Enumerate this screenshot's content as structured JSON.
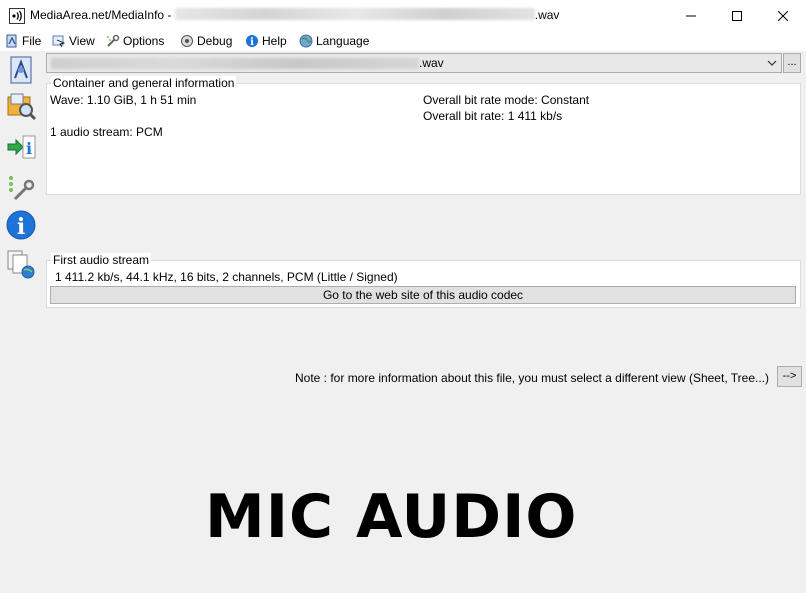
{
  "window": {
    "title_prefix": "MediaArea.net/MediaInfo - ",
    "title_suffix": ".wav"
  },
  "menu": {
    "file": "File",
    "view": "View",
    "options": "Options",
    "debug": "Debug",
    "help": "Help",
    "language": "Language"
  },
  "file_selector": {
    "ext": ".wav",
    "browse_label": "..."
  },
  "container": {
    "title": "Container and general information",
    "format_line": "Wave: 1.10 GiB, 1 h 51 min",
    "streams_line": "1 audio stream: PCM",
    "bitrate_mode": "Overall bit rate mode: Constant",
    "bitrate": "Overall bit rate: 1 411 kb/s"
  },
  "audio": {
    "title": "First audio stream",
    "details": "1 411.2 kb/s, 44.1 kHz, 16 bits, 2 channels, PCM (Little / Signed)",
    "codec_button": "Go to the web site of this audio codec"
  },
  "note": {
    "text": "Note : for more information about this file, you must select a different view (Sheet, Tree...)",
    "button": "-->"
  },
  "overlay_text": "MIC AUDIO",
  "colors": {
    "background": "#f0f0f0",
    "panel": "#ffffff",
    "border": "#dcdcdc",
    "button": "#e1e1e1",
    "info_blue": "#1e73d8"
  }
}
